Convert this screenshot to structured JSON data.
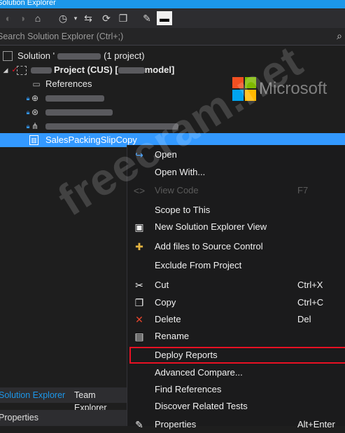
{
  "window": {
    "title": "Solution Explorer"
  },
  "toolbar": {
    "buttons": [
      {
        "name": "back-icon",
        "glyph": "◐"
      },
      {
        "name": "forward-icon",
        "glyph": "◑"
      },
      {
        "name": "home-icon",
        "glyph": "⌂"
      },
      {
        "name": "history-icon",
        "glyph": "◷"
      },
      {
        "name": "sync-icon",
        "glyph": "⇆"
      },
      {
        "name": "refresh-icon",
        "glyph": "⟳"
      },
      {
        "name": "collapse-icon",
        "glyph": "❐"
      },
      {
        "name": "properties-wrench-icon",
        "glyph": "✎"
      },
      {
        "name": "preview-icon",
        "glyph": "▬"
      }
    ]
  },
  "search": {
    "placeholder": "Search Solution Explorer (Ctrl+;)"
  },
  "tree": {
    "solution_prefix": "Solution '",
    "solution_suffix": "(1 project)",
    "project_a": "Project (CUS) [",
    "project_b": "model]",
    "references": "References",
    "selected_item": "SalesPackingSlipCopy"
  },
  "logo": {
    "text": "Microsoft"
  },
  "watermark": {
    "text": "freecram.net"
  },
  "context_menu": {
    "items": [
      {
        "label": "Open",
        "shortcut": "",
        "icon": "↪",
        "icon_name": "open-icon",
        "color": "#3399ff"
      },
      {
        "label": "Open With...",
        "shortcut": "",
        "icon": "",
        "icon_name": ""
      },
      {
        "label": "View Code",
        "shortcut": "F7",
        "icon": "<>",
        "icon_name": "view-code-icon",
        "disabled": true
      },
      {
        "label": "Scope to This",
        "shortcut": "",
        "icon": "",
        "icon_name": ""
      },
      {
        "label": "New Solution Explorer View",
        "shortcut": "",
        "icon": "▣",
        "icon_name": "new-view-icon"
      },
      {
        "label": "Add files to Source Control",
        "shortcut": "",
        "icon": "✚",
        "icon_name": "source-control-icon",
        "color": "#e3b341"
      },
      {
        "label": "Exclude From Project",
        "shortcut": "",
        "icon": "",
        "icon_name": ""
      },
      {
        "label": "Cut",
        "shortcut": "Ctrl+X",
        "icon": "✂",
        "icon_name": "cut-icon"
      },
      {
        "label": "Copy",
        "shortcut": "Ctrl+C",
        "icon": "❐",
        "icon_name": "copy-icon"
      },
      {
        "label": "Delete",
        "shortcut": "Del",
        "icon": "✕",
        "icon_name": "delete-icon",
        "color": "#e8452c"
      },
      {
        "label": "Rename",
        "shortcut": "",
        "icon": "▤",
        "icon_name": "rename-icon"
      },
      {
        "label": "Deploy Reports",
        "shortcut": "",
        "icon": "",
        "icon_name": "",
        "highlighted": true
      },
      {
        "label": "Advanced Compare...",
        "shortcut": "",
        "icon": "",
        "icon_name": ""
      },
      {
        "label": "Find References",
        "shortcut": "",
        "icon": "",
        "icon_name": ""
      },
      {
        "label": "Discover Related Tests",
        "shortcut": "",
        "icon": "",
        "icon_name": ""
      },
      {
        "label": "Properties",
        "shortcut": "Alt+Enter",
        "icon": "✎",
        "icon_name": "properties-icon"
      }
    ]
  },
  "bottom_tabs": [
    {
      "label": "Solution Explorer",
      "active": true
    },
    {
      "label": "Team Explorer",
      "active": false
    }
  ],
  "properties_panel": {
    "title": "Properties"
  },
  "colors": {
    "accent": "#3399ff",
    "title_bar": "#1c97ea",
    "highlight_border": "#e81123"
  }
}
